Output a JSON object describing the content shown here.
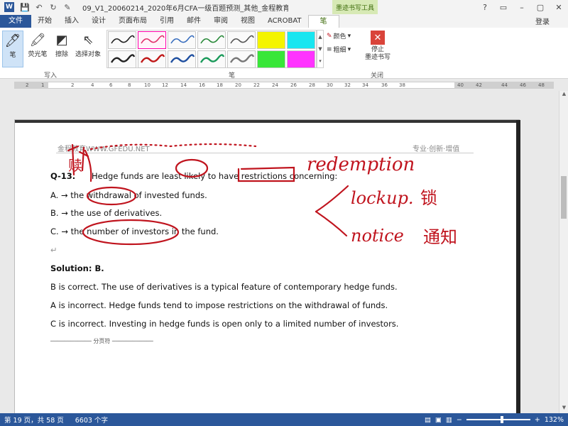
{
  "window": {
    "title": "09_V1_20060214_2020年6月CFA一级百题预测_其他_金程教育（授...",
    "context_tab": "墨迹书写工具",
    "login": "登录",
    "qat": [
      "💾",
      "↶",
      "↻",
      "✎"
    ],
    "controls": [
      "?",
      "▭",
      "–",
      "▢",
      "✕"
    ]
  },
  "tabs": [
    "文件",
    "开始",
    "插入",
    "设计",
    "页面布局",
    "引用",
    "邮件",
    "审阅",
    "视图",
    "ACROBAT",
    "笔"
  ],
  "ribbon": {
    "tools": [
      "笔",
      "荧光笔",
      "擦除",
      "选择对象"
    ],
    "group_write": "写入",
    "group_pen": "笔",
    "group_close": "关闭",
    "color_label": "颜色",
    "thickness_label": "粗细",
    "stop_label_1": "停止",
    "stop_label_2": "墨迹书写",
    "pens": [
      {
        "color": "#222222",
        "kind": "pen"
      },
      {
        "color": "#e0306a",
        "kind": "pen"
      },
      {
        "color": "#3a6fbf",
        "kind": "pen"
      },
      {
        "color": "#2a8a3a",
        "kind": "pen"
      },
      {
        "color": "#555555",
        "kind": "pen"
      },
      {
        "color": "#f4f400",
        "kind": "highlighter"
      },
      {
        "color": "#19e6f0",
        "kind": "highlighter"
      },
      {
        "color": "#222222",
        "kind": "pen"
      },
      {
        "color": "#c01818",
        "kind": "pen"
      },
      {
        "color": "#1f4fa0",
        "kind": "pen"
      },
      {
        "color": "#1a9a5a",
        "kind": "pen"
      },
      {
        "color": "#777777",
        "kind": "pen"
      },
      {
        "color": "#39e639",
        "kind": "highlighter"
      },
      {
        "color": "#ff33ff",
        "kind": "highlighter"
      }
    ]
  },
  "ruler": {
    "ticks": [
      "2",
      "1",
      "2",
      "4",
      "6",
      "8",
      "10",
      "12",
      "14",
      "16",
      "18",
      "20",
      "22",
      "24",
      "26",
      "28",
      "30",
      "32",
      "34",
      "36",
      "38",
      "40",
      "42",
      "44",
      "46",
      "48"
    ]
  },
  "document": {
    "header_left": "金程教育WWW.GFEDU.NET",
    "header_right": "专业·创新·增值",
    "q_number": "Q-13.",
    "q_text": "Hedge funds are least likely to have restrictions concerning:",
    "option_a": "A. →  the withdrawal of invested funds.",
    "option_b": "B. →  the use of derivatives.",
    "option_c": "C. →  the number of investors in the fund.",
    "solution": "Solution: B.",
    "exp_1": "B is correct. The use of derivatives is a typical feature of contemporary hedge funds.",
    "exp_2": "A is incorrect. Hedge funds tend to impose restrictions on the withdrawal of funds.",
    "exp_3": "C is incorrect. Investing in hedge funds is open only to a limited number of investors.",
    "page_break": "分页符"
  },
  "annotations": {
    "note_top": "redemption",
    "note_mid": "lockup.",
    "note_mid_cn": "锁",
    "note_low": "notice",
    "note_low_cn": "通知",
    "note_left": "赎",
    "ink_color": "#c0141e"
  },
  "status": {
    "page": "第 19 页，共 58 页",
    "words": "6603 个字",
    "zoom": "132%"
  }
}
